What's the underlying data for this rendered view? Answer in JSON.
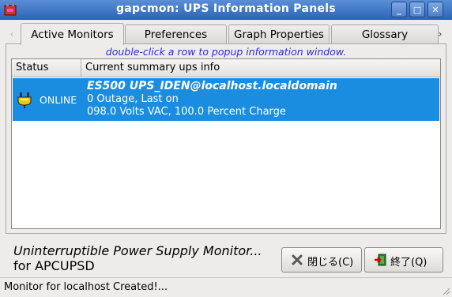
{
  "window": {
    "title": "gapcmon: UPS Information Panels",
    "minimize_glyph": "_",
    "maximize_glyph": "□",
    "close_glyph": "✕"
  },
  "tabs": [
    {
      "label": "Active Monitors",
      "active": true
    },
    {
      "label": "Preferences",
      "active": false
    },
    {
      "label": "Graph Properties",
      "active": false
    },
    {
      "label": "Glossary",
      "active": false
    }
  ],
  "tab_scroll": {
    "left": "‹",
    "right": "›"
  },
  "monitors": {
    "hint": "double-click a row to popup information window.",
    "columns": [
      "Status",
      "Current summary ups info"
    ],
    "rows": [
      {
        "status": "ONLINE",
        "title": "ES500  UPS_IDEN@localhost.localdomain",
        "line2": "0 Outage, Last on",
        "line3": "098.0 Volts VAC, 100.0 Percent Charge",
        "icon": "power-plug-icon"
      }
    ]
  },
  "footer": {
    "line1": "Uninterruptible Power Supply Monitor...",
    "line2": "for APCUPSD",
    "close_button": "閉じる(C)",
    "quit_button": "終了(Q)"
  },
  "statusbar": {
    "text": "Monitor for localhost Created!..."
  },
  "colors": {
    "titlebar": "#3c74c8",
    "selection": "#1b8de0",
    "hint": "#2b2bd0"
  }
}
